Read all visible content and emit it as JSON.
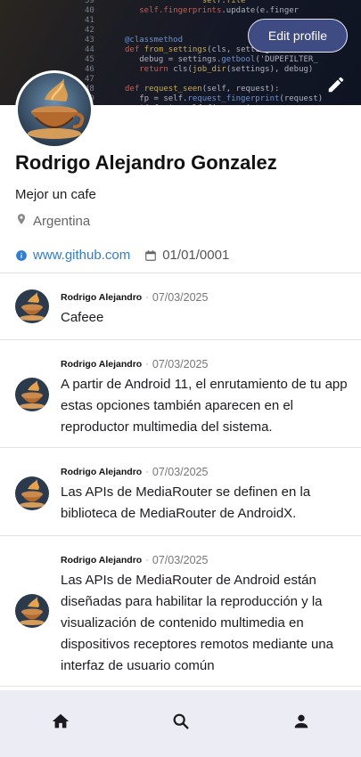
{
  "header": {
    "edit_label": "Edit profile"
  },
  "profile": {
    "name": "Rodrigo Alejandro Gonzalez",
    "bio": "Mejor un cafe",
    "location": "Argentina",
    "website": "www.github.com",
    "joined": "01/01/0001"
  },
  "posts": [
    {
      "author": "Rodrigo Alejandro",
      "date": "07/03/2025",
      "text": "Cafeee"
    },
    {
      "author": "Rodrigo Alejandro",
      "date": "07/03/2025",
      "text": "A partir de Android 11, el enrutamiento de tu app estas opciones también aparecen en el reproductor multimedia del sistema."
    },
    {
      "author": "Rodrigo Alejandro",
      "date": "07/03/2025",
      "text": "Las APIs de MediaRouter se definen en la biblioteca de MediaRouter de AndroidX."
    },
    {
      "author": "Rodrigo Alejandro",
      "date": "07/03/2025",
      "text": "Las APIs de MediaRouter de Android están diseñadas para habilitar la reproducción y la visualización de contenido multimedia en dispositivos receptores remotos mediante una interfaz de usuario común"
    }
  ],
  "nav": {
    "icons": [
      "home-icon",
      "search-icon",
      "profile-icon"
    ]
  },
  "colors": {
    "accent": "#3f4b83",
    "link": "#2f7dd6",
    "nav_bg": "#ececf4"
  }
}
